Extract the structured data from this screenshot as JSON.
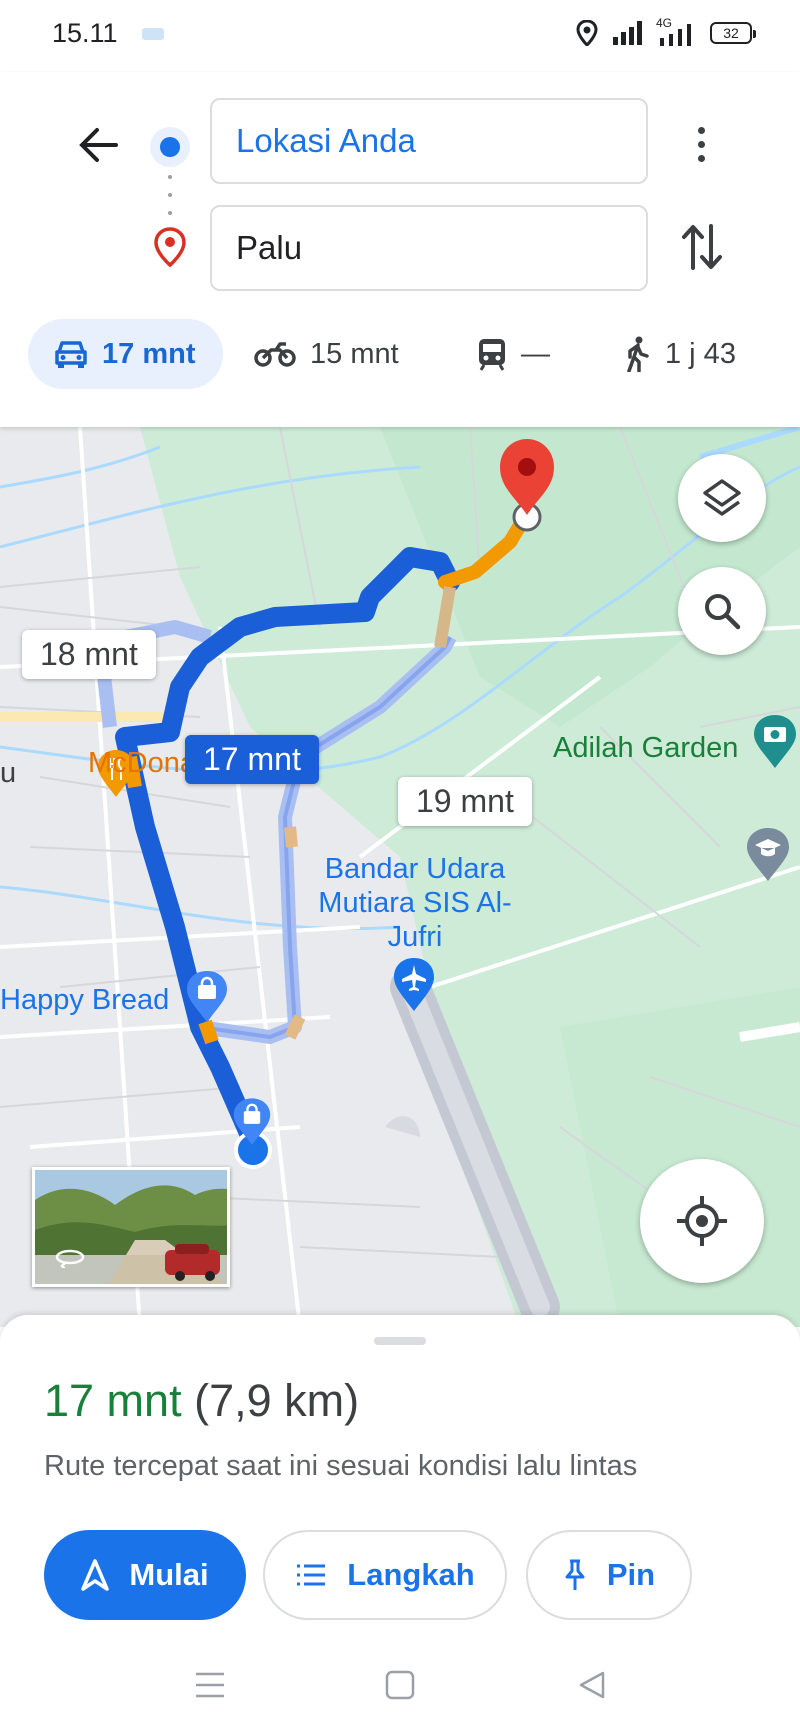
{
  "status_bar": {
    "time": "15.11",
    "network": "4G",
    "battery": "32",
    "icons": [
      "location-icon",
      "signal-icon",
      "signal-4g-icon",
      "battery-icon"
    ]
  },
  "search": {
    "origin": "Lokasi Anda",
    "destination": "Palu"
  },
  "travel_modes": [
    {
      "icon": "car-icon",
      "label": "17 mnt",
      "selected": true
    },
    {
      "icon": "motorcycle-icon",
      "label": "15 mnt",
      "selected": false
    },
    {
      "icon": "train-icon",
      "label": "—",
      "selected": false
    },
    {
      "icon": "walk-icon",
      "label": "1 j 43",
      "selected": false
    }
  ],
  "map": {
    "places": {
      "mcdonalds": "McDonald's Palu",
      "adilah": "Adilah Garden",
      "airport": "Bandar Udara Mutiara SIS Al-Jufri",
      "happy_bread": "Happy Bread",
      "left_edge_fragment": "u"
    },
    "route_labels": {
      "alt_left": "18 mnt",
      "selected": "17 mnt",
      "alt_right": "19 mnt"
    },
    "colors": {
      "route_selected": "#1a5fd8",
      "route_alt": "#a9bff2",
      "traffic_slow": "#f29900",
      "pin": "#ea4335",
      "park": "#c8ecd5"
    }
  },
  "sheet": {
    "duration": "17 mnt",
    "distance": "(7,9 km)",
    "subtitle": "Rute tercepat saat ini sesuai kondisi lalu lintas",
    "buttons": {
      "start": "Mulai",
      "steps": "Langkah",
      "pin": "Pin"
    }
  }
}
